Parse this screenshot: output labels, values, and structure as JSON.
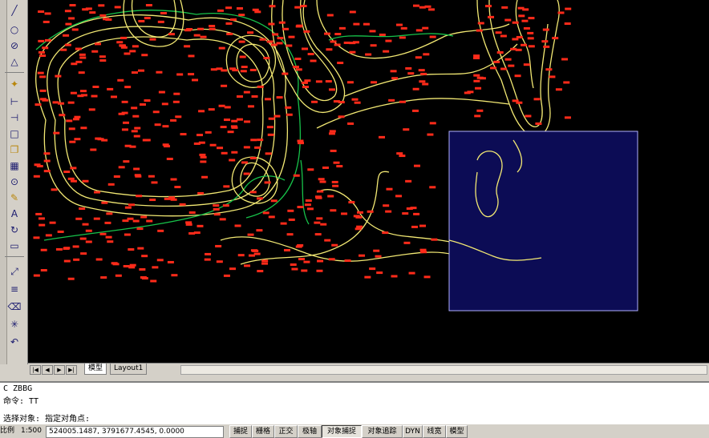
{
  "toolbar": {
    "buttons": [
      "draw-line",
      "circle",
      "no-entry",
      "triangle",
      "ortho-snap",
      "dim-linear",
      "dim-aligned",
      "square",
      "copy",
      "hatch",
      "node",
      "align",
      "pencil",
      "text-a",
      "rotate",
      "block",
      "scale"
    ]
  },
  "canvas": {
    "bg": "#000000",
    "contour_color": "#f2e873",
    "shoreline_color": "#17c24a",
    "point_color": "#ff2b1a",
    "selection_fill": "#0c0c55",
    "selection_border": "#b0b0ff"
  },
  "tabs": {
    "nav": [
      "|◀",
      "◀",
      "▶",
      "▶|"
    ],
    "model": "模型",
    "layout": "Layout1"
  },
  "command": {
    "line1": "C ZBBG",
    "line2": "命令: TT",
    "line3": "选择对象: 指定对角点:"
  },
  "status": {
    "scale_label": "比例",
    "scale_value": "1:500",
    "coords": "524005.1487, 3791677.4545, 0.0000",
    "buttons": [
      {
        "label": "捕捉",
        "on": false
      },
      {
        "label": "栅格",
        "on": false
      },
      {
        "label": "正交",
        "on": false
      },
      {
        "label": "极轴",
        "on": false
      },
      {
        "label": "对象捕捉",
        "on": true
      },
      {
        "label": "对象追踪",
        "on": false
      },
      {
        "label": "DYN",
        "on": false
      },
      {
        "label": "线宽",
        "on": false
      },
      {
        "label": "模型",
        "on": false
      }
    ]
  }
}
